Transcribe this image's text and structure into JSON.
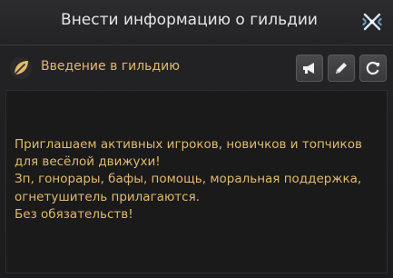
{
  "header": {
    "title": "Внести информацию о гильдии",
    "close_icon": "crossed-swords-close-icon"
  },
  "section": {
    "icon": "leaf-icon",
    "title": "Введение в гильдию",
    "buttons": [
      {
        "icon": "megaphone-icon"
      },
      {
        "icon": "pencil-icon"
      },
      {
        "icon": "refresh-icon"
      }
    ]
  },
  "intro": {
    "text": "Приглашаем активных игроков, новичков и топчиков для весёлой движухи!\nЗп, гонорары, бафы, помощь, моральная поддержка, огнетушитель прилагаются.\nБез обязательств!"
  },
  "colors": {
    "accent": "#e1b96b",
    "title_text": "#e6e6e6",
    "panel_bg": "#1a1a1b"
  }
}
